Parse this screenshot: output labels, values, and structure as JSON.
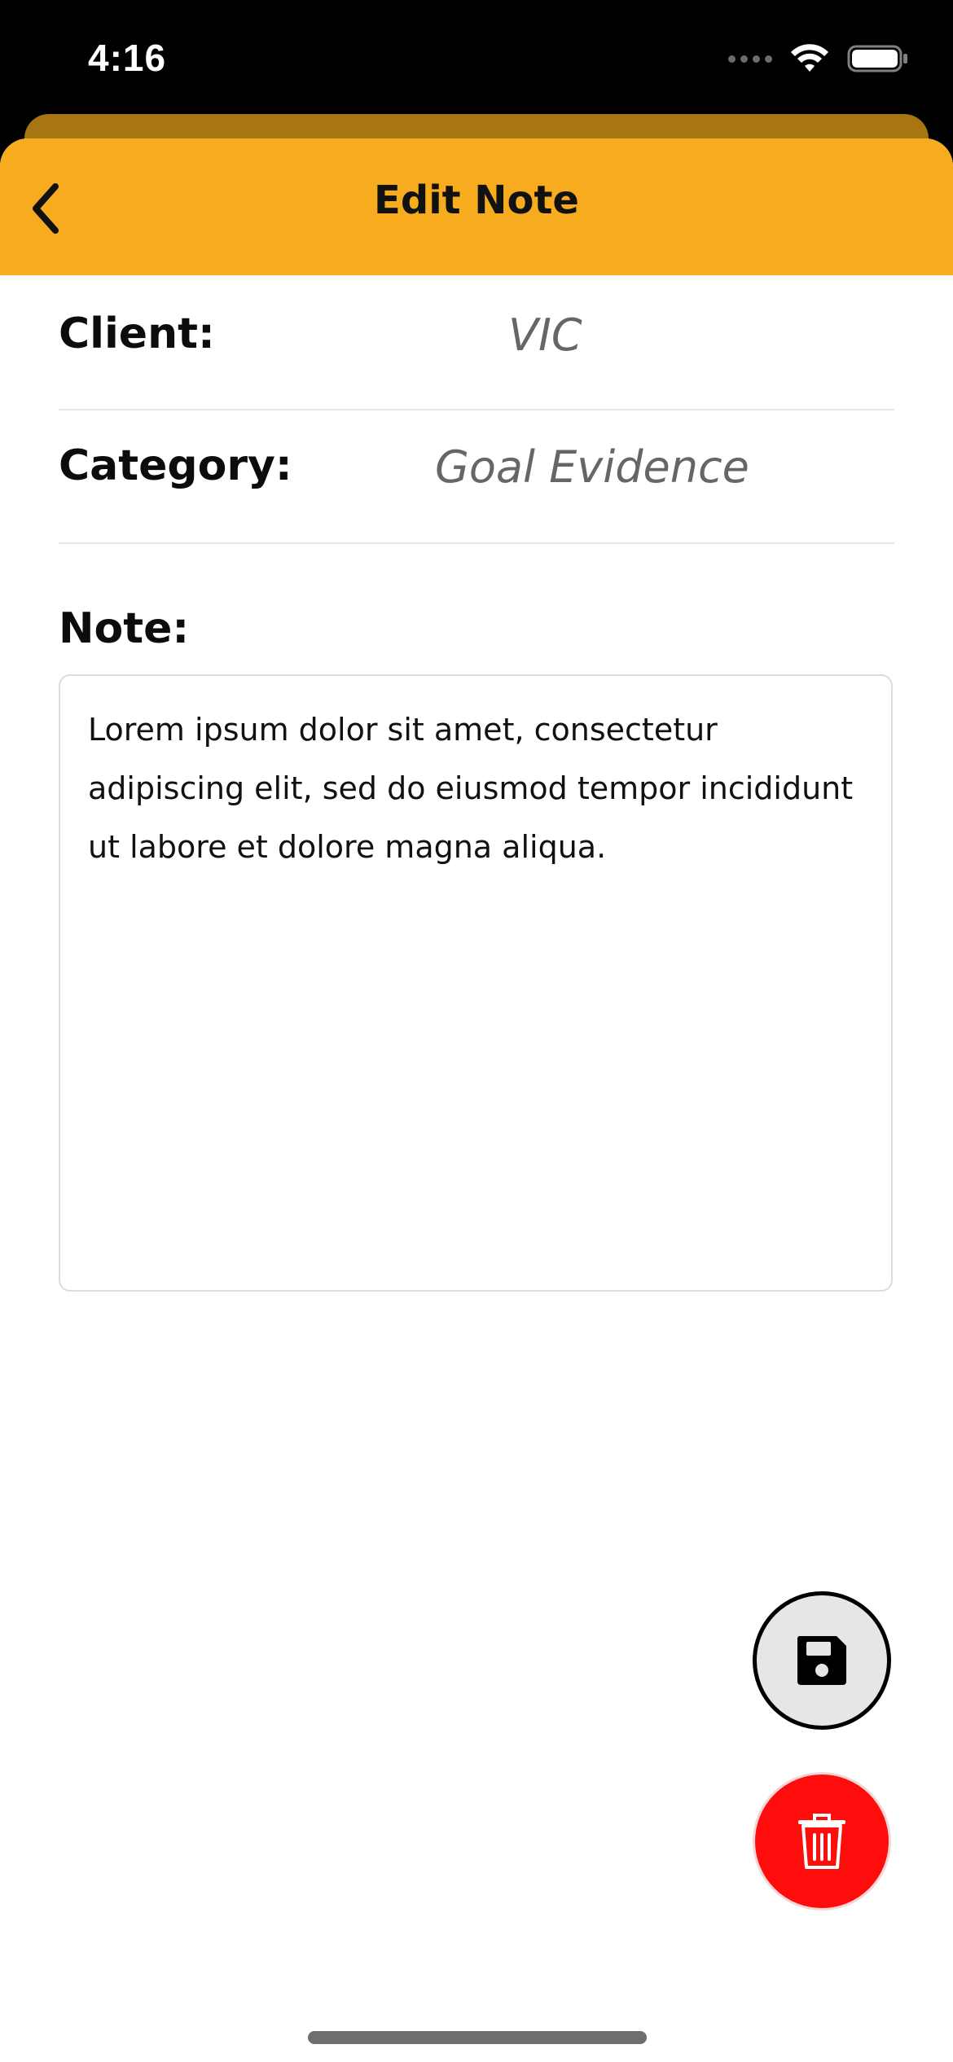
{
  "status_bar": {
    "time": "4:16"
  },
  "nav": {
    "title": "Edit Note",
    "back_icon": "chevron-left-icon"
  },
  "fields": {
    "client_label": "Client:",
    "client_value": "VIC",
    "category_label": "Category:",
    "category_value": "Goal Evidence",
    "note_label": "Note:",
    "note_text": "Lorem ipsum dolor sit amet, consectetur adipiscing elit, sed do eiusmod tempor incididunt ut labore et dolore magna aliqua."
  },
  "actions": {
    "save_icon": "floppy-disk-icon",
    "delete_icon": "trash-icon"
  },
  "colors": {
    "header_bg": "#f7ab1f",
    "delete_bg": "#ff0d0d",
    "save_bg": "#e6e6e6"
  }
}
